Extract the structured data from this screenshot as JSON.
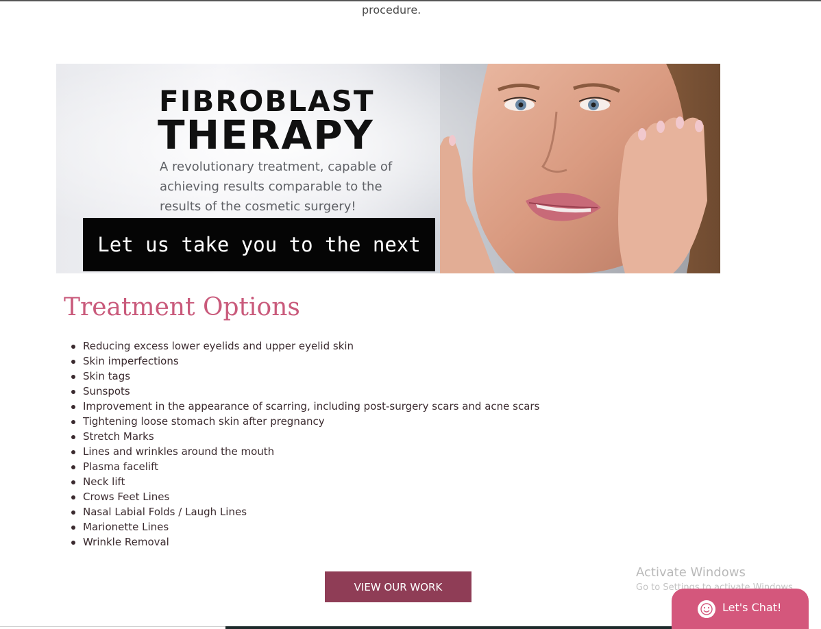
{
  "intro": {
    "procedure_text": "procedure."
  },
  "banner": {
    "title_line1": "FIBROBLAST",
    "title_line2": "THERAPY",
    "description": "A revolutionary treatment, capable of achieving results comparable to the results of the cosmetic surgery!",
    "cta": "Let us take you to the next level"
  },
  "treatments": {
    "heading": "Treatment Options",
    "items": [
      "Reducing excess lower eyelids and upper eyelid skin",
      "Skin imperfections",
      "Skin tags",
      "Sunspots",
      "Improvement in the appearance of scarring, including post-surgery scars and acne scars",
      "Tightening loose stomach skin after pregnancy",
      "Stretch Marks",
      "Lines and wrinkles around the mouth",
      "Plasma facelift",
      "Neck lift",
      "Crows Feet Lines",
      "Nasal Labial Folds / Laugh Lines",
      "Marionette Lines",
      "Wrinkle Removal"
    ],
    "button_label": "VIEW OUR WORK"
  },
  "windows_watermark": {
    "title": "Activate Windows",
    "subtitle": "Go to Settings to activate Windows."
  },
  "chat": {
    "label": "Let's Chat!",
    "icon": "smiley-icon"
  },
  "colors": {
    "heading": "#c95a7b",
    "button": "#8f3d56",
    "chat": "#d4577c",
    "text": "#3b2b2f"
  }
}
